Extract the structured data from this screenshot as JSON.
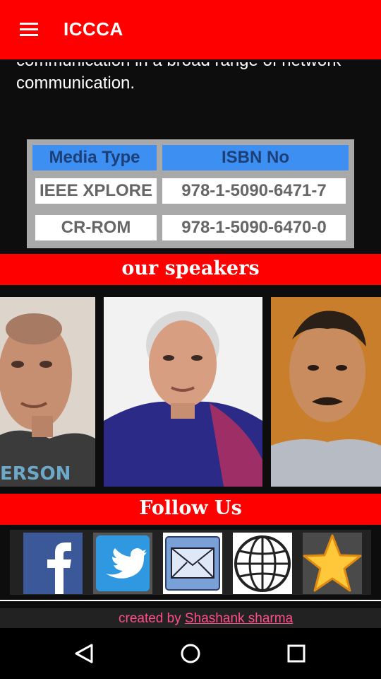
{
  "app": {
    "title": "ICCCA"
  },
  "intro": {
    "text": "communication in a broad range of network communication."
  },
  "isbn_table": {
    "headers": [
      "Media Type",
      "ISBN No"
    ],
    "rows": [
      [
        "IEEE XPLORE",
        "978-1-5090-6471-7"
      ],
      [
        "CR-ROM",
        "978-1-5090-6470-0"
      ]
    ]
  },
  "speakers": {
    "heading": "our speakers"
  },
  "follow": {
    "heading": "Follow Us",
    "icons": [
      "facebook-icon",
      "twitter-icon",
      "mail-icon",
      "globe-icon",
      "star-icon"
    ]
  },
  "footer": {
    "prefix": "created by ",
    "author": "Shashank sharma"
  },
  "colors": {
    "app_bar": "#ff0000",
    "header_cell": "#3d8ff2",
    "header_text": "#1d3f78",
    "credit_text": "#ff4d8a"
  }
}
